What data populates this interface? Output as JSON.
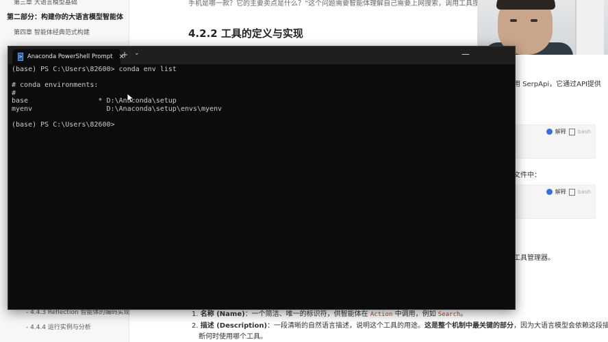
{
  "sidebar": {
    "items": [
      {
        "label": "第三章 大语言模型基础"
      },
      {
        "label": "第二部分：构建你的大语言模型智能体"
      },
      {
        "label": "第四章 智能体经典范式构建"
      },
      {
        "label": "- 4.4.3 Reflection 智能体的编码实现"
      },
      {
        "label": "- 4.4.4 运行实例与分析"
      }
    ]
  },
  "doc": {
    "top_line": "手机是哪一款？它的主要卖点是什么？”这个问题需要智能体理解自己需要上网搜索，调用工具搜索结",
    "heading": "4.2.2 工具的定义与实现",
    "side_serpapi": "用 SerpApi，它通过API提供",
    "side_file": "文件中：",
    "side_manager": "工具管理器。",
    "code_actions": {
      "explain": "解释",
      "copy": "bash"
    },
    "list": [
      {
        "num": "1.",
        "title": "名称 (Name)",
        "text_before": "：一个简洁、唯一的标识符，供智能体在",
        "code1": "Action",
        "text_mid": "中调用，例如",
        "code2": "Search",
        "text_after": "。"
      },
      {
        "num": "2.",
        "title": "描述 (Description)",
        "text_before": "：一段清晰的自然语言描述，说明这个工具的用途。",
        "bold": "这是整个机制中最关键的部分",
        "text_after": "，因为大语言模型会依赖这段描述来判"
      },
      {
        "cont": "断何时使用哪个工具。"
      }
    ]
  },
  "terminal": {
    "tab_title": "Anaconda PowerShell Prompt",
    "tab_icon": "terminal-icon",
    "close_glyph": "✕",
    "new_tab_glyph": "+",
    "menu_glyph": "⌄",
    "minimize_glyph": "—",
    "lines": [
      "(base) PS C:\\Users\\82600> conda env list",
      "",
      "# conda environments:",
      "#",
      "base                 * D:\\Anaconda\\setup",
      "myenv                  D:\\Anaconda\\setup\\envs\\myenv",
      "",
      "(base) PS C:\\Users\\82600>"
    ]
  },
  "colors": {
    "terminal_bg": "#0c0c0c",
    "terminal_fg": "#cccccc",
    "titlebar_bg": "#1f1f1f"
  }
}
